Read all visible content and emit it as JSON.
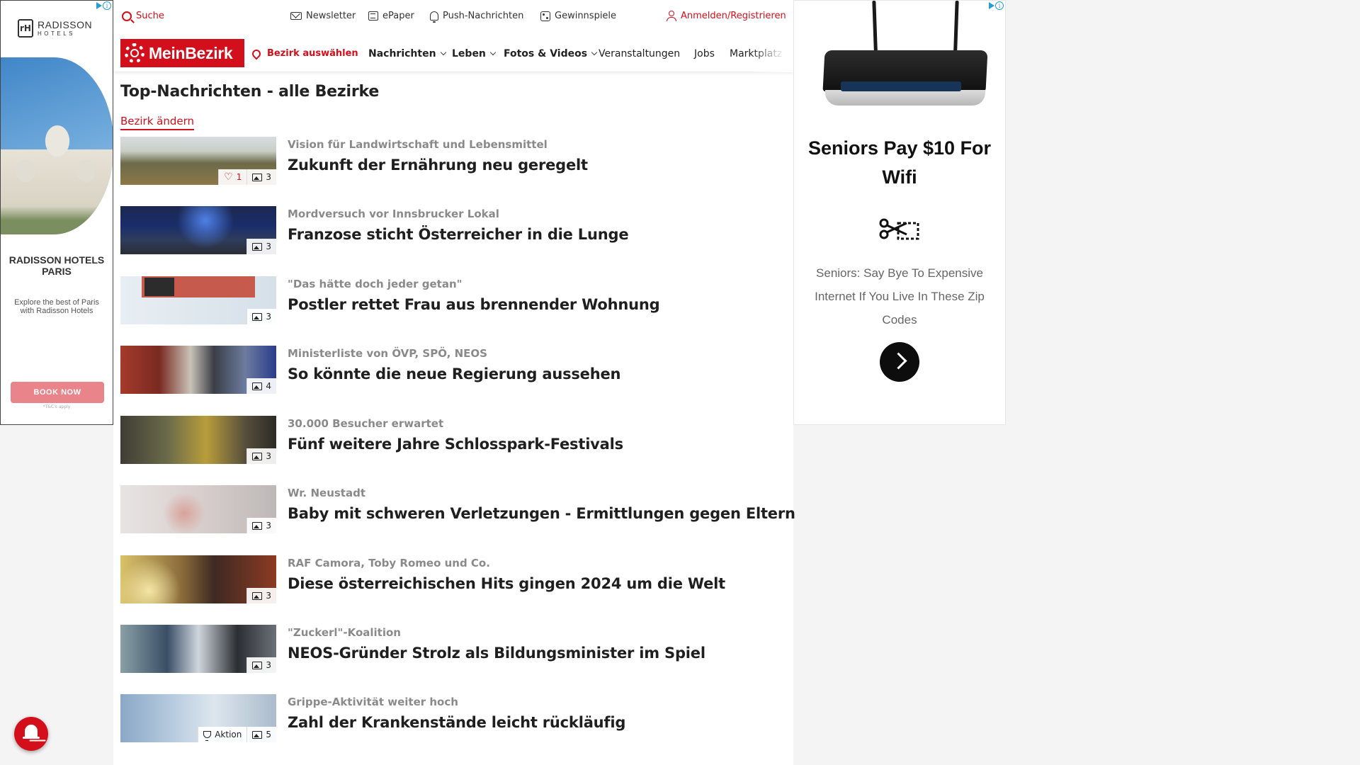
{
  "ad_left": {
    "brand_line1": "RADISSON",
    "brand_line2": "HOTELS",
    "mark": "rH",
    "title": "RADISSON HOTELS PARIS",
    "description": "Explore the best of Paris with Radisson Hotels",
    "cta": "BOOK NOW",
    "terms": "*T&C's apply"
  },
  "topbar": {
    "search": "Suche",
    "newsletter": "Newsletter",
    "epaper": "ePaper",
    "push": "Push-Nachrichten",
    "games": "Gewinnspiele",
    "login": "Anmelden/Registrieren"
  },
  "nav": {
    "logo": "MeinBezirk",
    "district": "Bezirk auswählen",
    "items": [
      "Nachrichten",
      "Leben",
      "Fotos & Videos",
      "Veranstaltungen",
      "Jobs",
      "Marktplatz"
    ]
  },
  "page": {
    "title": "Top-Nachrichten - alle Bezirke",
    "change_link": "Bezirk ändern"
  },
  "articles": [
    {
      "kicker": "Vision für Landwirtschaft und Lebensmittel",
      "headline": "Zukunft der Ernährung neu geregelt",
      "likes": "1",
      "images": "3"
    },
    {
      "kicker": "Mordversuch vor Innsbrucker Lokal",
      "headline": "Franzose sticht Österreicher in die Lunge",
      "images": "3"
    },
    {
      "kicker": "\"Das hätte doch jeder getan\"",
      "headline": "Postler rettet Frau aus brennender Wohnung",
      "images": "3"
    },
    {
      "kicker": "Ministerliste von ÖVP, SPÖ, NEOS",
      "headline": "So könnte die neue Regierung aussehen",
      "images": "4"
    },
    {
      "kicker": "30.000 Besucher erwartet",
      "headline": "Fünf weitere Jahre Schlosspark-Festivals",
      "images": "3"
    },
    {
      "kicker": "Wr. Neustadt",
      "headline": "Baby mit schweren Verletzungen - Ermittlungen gegen Eltern",
      "images": "3"
    },
    {
      "kicker": "RAF Camora, Toby Romeo und Co.",
      "headline": "Diese österreichischen Hits gingen 2024 um die Welt",
      "images": "3"
    },
    {
      "kicker": "\"Zuckerl\"-Koalition",
      "headline": "NEOS-Gründer Strolz als Bildungsminister im Spiel",
      "images": "3"
    },
    {
      "kicker": "Grippe-Aktivität weiter hoch",
      "headline": "Zahl der Krankenstände leicht rückläufig",
      "action": "Aktion",
      "images": "5"
    }
  ],
  "ad_right": {
    "headline": "Seniors Pay $10 For Wifi",
    "body": "Seniors: Say Bye To Expensive Internet If You Live In These Zip Codes",
    "icon": "scissors-coupon-icon"
  },
  "colors": {
    "brand_red": "#d20f1a",
    "kicker_gray": "#8a8a8a",
    "headline": "#1f1f1f"
  }
}
